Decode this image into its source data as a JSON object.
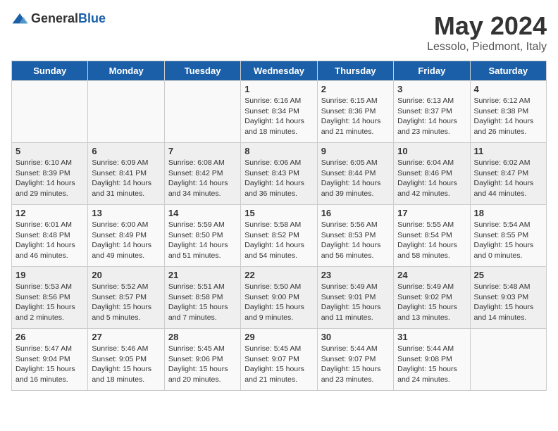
{
  "header": {
    "logo_general": "General",
    "logo_blue": "Blue",
    "title": "May 2024",
    "subtitle": "Lessolo, Piedmont, Italy"
  },
  "days_of_week": [
    "Sunday",
    "Monday",
    "Tuesday",
    "Wednesday",
    "Thursday",
    "Friday",
    "Saturday"
  ],
  "weeks": [
    [
      {
        "day": "",
        "detail": ""
      },
      {
        "day": "",
        "detail": ""
      },
      {
        "day": "",
        "detail": ""
      },
      {
        "day": "1",
        "detail": "Sunrise: 6:16 AM\nSunset: 8:34 PM\nDaylight: 14 hours\nand 18 minutes."
      },
      {
        "day": "2",
        "detail": "Sunrise: 6:15 AM\nSunset: 8:36 PM\nDaylight: 14 hours\nand 21 minutes."
      },
      {
        "day": "3",
        "detail": "Sunrise: 6:13 AM\nSunset: 8:37 PM\nDaylight: 14 hours\nand 23 minutes."
      },
      {
        "day": "4",
        "detail": "Sunrise: 6:12 AM\nSunset: 8:38 PM\nDaylight: 14 hours\nand 26 minutes."
      }
    ],
    [
      {
        "day": "5",
        "detail": "Sunrise: 6:10 AM\nSunset: 8:39 PM\nDaylight: 14 hours\nand 29 minutes."
      },
      {
        "day": "6",
        "detail": "Sunrise: 6:09 AM\nSunset: 8:41 PM\nDaylight: 14 hours\nand 31 minutes."
      },
      {
        "day": "7",
        "detail": "Sunrise: 6:08 AM\nSunset: 8:42 PM\nDaylight: 14 hours\nand 34 minutes."
      },
      {
        "day": "8",
        "detail": "Sunrise: 6:06 AM\nSunset: 8:43 PM\nDaylight: 14 hours\nand 36 minutes."
      },
      {
        "day": "9",
        "detail": "Sunrise: 6:05 AM\nSunset: 8:44 PM\nDaylight: 14 hours\nand 39 minutes."
      },
      {
        "day": "10",
        "detail": "Sunrise: 6:04 AM\nSunset: 8:46 PM\nDaylight: 14 hours\nand 42 minutes."
      },
      {
        "day": "11",
        "detail": "Sunrise: 6:02 AM\nSunset: 8:47 PM\nDaylight: 14 hours\nand 44 minutes."
      }
    ],
    [
      {
        "day": "12",
        "detail": "Sunrise: 6:01 AM\nSunset: 8:48 PM\nDaylight: 14 hours\nand 46 minutes."
      },
      {
        "day": "13",
        "detail": "Sunrise: 6:00 AM\nSunset: 8:49 PM\nDaylight: 14 hours\nand 49 minutes."
      },
      {
        "day": "14",
        "detail": "Sunrise: 5:59 AM\nSunset: 8:50 PM\nDaylight: 14 hours\nand 51 minutes."
      },
      {
        "day": "15",
        "detail": "Sunrise: 5:58 AM\nSunset: 8:52 PM\nDaylight: 14 hours\nand 54 minutes."
      },
      {
        "day": "16",
        "detail": "Sunrise: 5:56 AM\nSunset: 8:53 PM\nDaylight: 14 hours\nand 56 minutes."
      },
      {
        "day": "17",
        "detail": "Sunrise: 5:55 AM\nSunset: 8:54 PM\nDaylight: 14 hours\nand 58 minutes."
      },
      {
        "day": "18",
        "detail": "Sunrise: 5:54 AM\nSunset: 8:55 PM\nDaylight: 15 hours\nand 0 minutes."
      }
    ],
    [
      {
        "day": "19",
        "detail": "Sunrise: 5:53 AM\nSunset: 8:56 PM\nDaylight: 15 hours\nand 2 minutes."
      },
      {
        "day": "20",
        "detail": "Sunrise: 5:52 AM\nSunset: 8:57 PM\nDaylight: 15 hours\nand 5 minutes."
      },
      {
        "day": "21",
        "detail": "Sunrise: 5:51 AM\nSunset: 8:58 PM\nDaylight: 15 hours\nand 7 minutes."
      },
      {
        "day": "22",
        "detail": "Sunrise: 5:50 AM\nSunset: 9:00 PM\nDaylight: 15 hours\nand 9 minutes."
      },
      {
        "day": "23",
        "detail": "Sunrise: 5:49 AM\nSunset: 9:01 PM\nDaylight: 15 hours\nand 11 minutes."
      },
      {
        "day": "24",
        "detail": "Sunrise: 5:49 AM\nSunset: 9:02 PM\nDaylight: 15 hours\nand 13 minutes."
      },
      {
        "day": "25",
        "detail": "Sunrise: 5:48 AM\nSunset: 9:03 PM\nDaylight: 15 hours\nand 14 minutes."
      }
    ],
    [
      {
        "day": "26",
        "detail": "Sunrise: 5:47 AM\nSunset: 9:04 PM\nDaylight: 15 hours\nand 16 minutes."
      },
      {
        "day": "27",
        "detail": "Sunrise: 5:46 AM\nSunset: 9:05 PM\nDaylight: 15 hours\nand 18 minutes."
      },
      {
        "day": "28",
        "detail": "Sunrise: 5:45 AM\nSunset: 9:06 PM\nDaylight: 15 hours\nand 20 minutes."
      },
      {
        "day": "29",
        "detail": "Sunrise: 5:45 AM\nSunset: 9:07 PM\nDaylight: 15 hours\nand 21 minutes."
      },
      {
        "day": "30",
        "detail": "Sunrise: 5:44 AM\nSunset: 9:07 PM\nDaylight: 15 hours\nand 23 minutes."
      },
      {
        "day": "31",
        "detail": "Sunrise: 5:44 AM\nSunset: 9:08 PM\nDaylight: 15 hours\nand 24 minutes."
      },
      {
        "day": "",
        "detail": ""
      }
    ]
  ]
}
